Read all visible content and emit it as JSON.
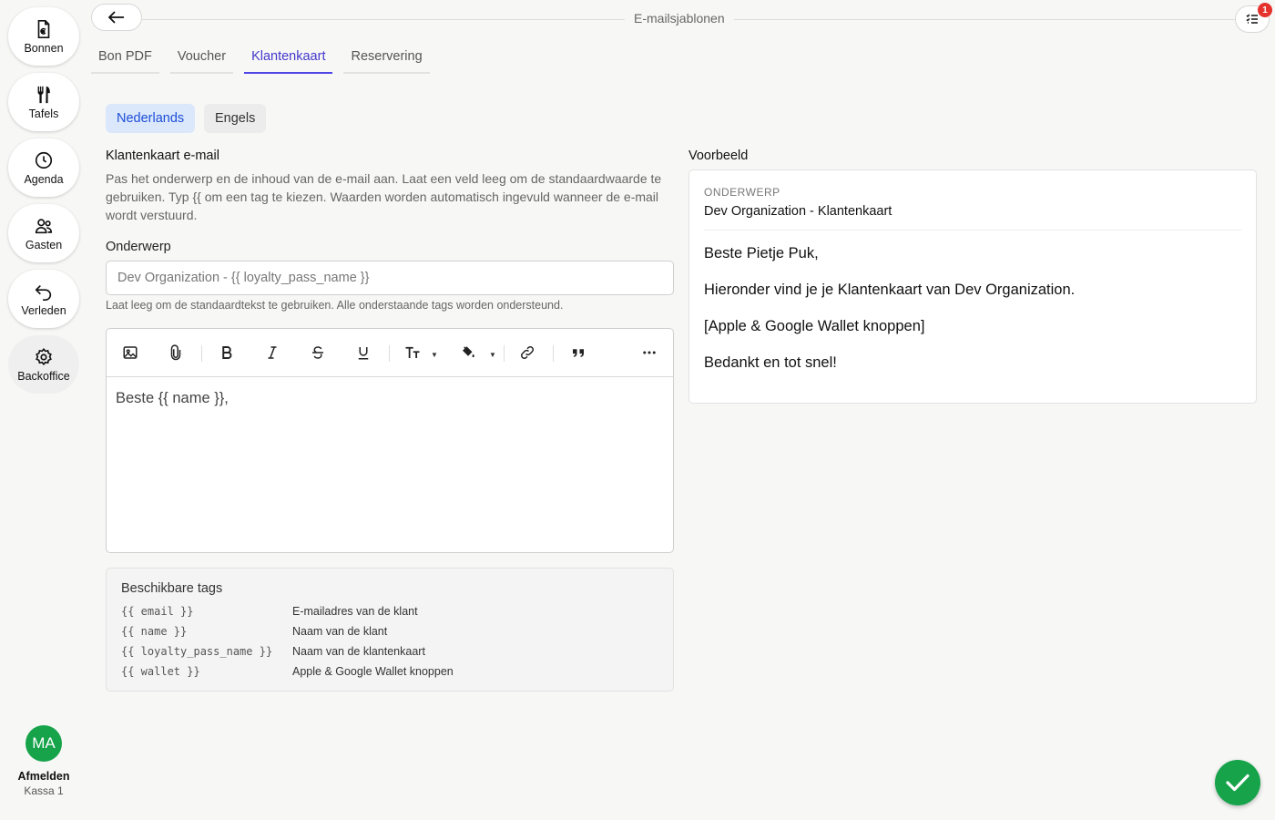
{
  "app": {
    "title": "E-mailsjablonen",
    "notification_count": "1"
  },
  "sidebar": {
    "items": [
      {
        "label": "Bonnen",
        "icon": "receipt-euro-icon"
      },
      {
        "label": "Tafels",
        "icon": "fork-knife-icon"
      },
      {
        "label": "Agenda",
        "icon": "clock-icon"
      },
      {
        "label": "Gasten",
        "icon": "users-icon"
      },
      {
        "label": "Verleden",
        "icon": "undo-arrow-icon"
      },
      {
        "label": "Backoffice",
        "icon": "gear-icon"
      }
    ],
    "user_initials": "MA",
    "logout_label": "Afmelden",
    "register_label": "Kassa 1"
  },
  "tabs": [
    {
      "label": "Bon PDF",
      "active": false
    },
    {
      "label": "Voucher",
      "active": false
    },
    {
      "label": "Klantenkaart",
      "active": true
    },
    {
      "label": "Reservering",
      "active": false
    }
  ],
  "languages": {
    "selected": "Nederlands",
    "other": "Engels"
  },
  "form": {
    "title": "Klantenkaart e-mail",
    "description": "Pas het onderwerp en de inhoud van de e-mail aan. Laat een veld leeg om de standaardwaarde te gebruiken. Typ {{ om een tag te kiezen. Waarden worden automatisch ingevuld wanneer de e-mail wordt verstuurd.",
    "subject_label": "Onderwerp",
    "subject_placeholder": "Dev Organization - {{ loyalty_pass_name }}",
    "subject_hint": "Laat leeg om de standaardtekst te gebruiken. Alle onderstaande tags worden ondersteund.",
    "body_placeholder": "Beste {{ name }},"
  },
  "tags": {
    "title": "Beschikbare tags",
    "items": [
      {
        "tag": "{{ email }}",
        "description": "E-mailadres van de klant"
      },
      {
        "tag": "{{ name }}",
        "description": "Naam van de klant"
      },
      {
        "tag": "{{ loyalty_pass_name }}",
        "description": "Naam van de klantenkaart"
      },
      {
        "tag": "{{ wallet }}",
        "description": "Apple & Google Wallet knoppen"
      }
    ]
  },
  "preview": {
    "label": "Voorbeeld",
    "subject_label": "ONDERWERP",
    "subject": "Dev Organization - Klantenkaart",
    "paragraphs": [
      "Beste Pietje Puk,",
      "Hieronder vind je je Klantenkaart van Dev Organization.",
      "[Apple & Google Wallet knoppen]",
      "Bedankt en tot snel!"
    ]
  },
  "colors": {
    "accent": "#4f46e5",
    "success": "#16a34a",
    "badge": "#e5322d"
  }
}
